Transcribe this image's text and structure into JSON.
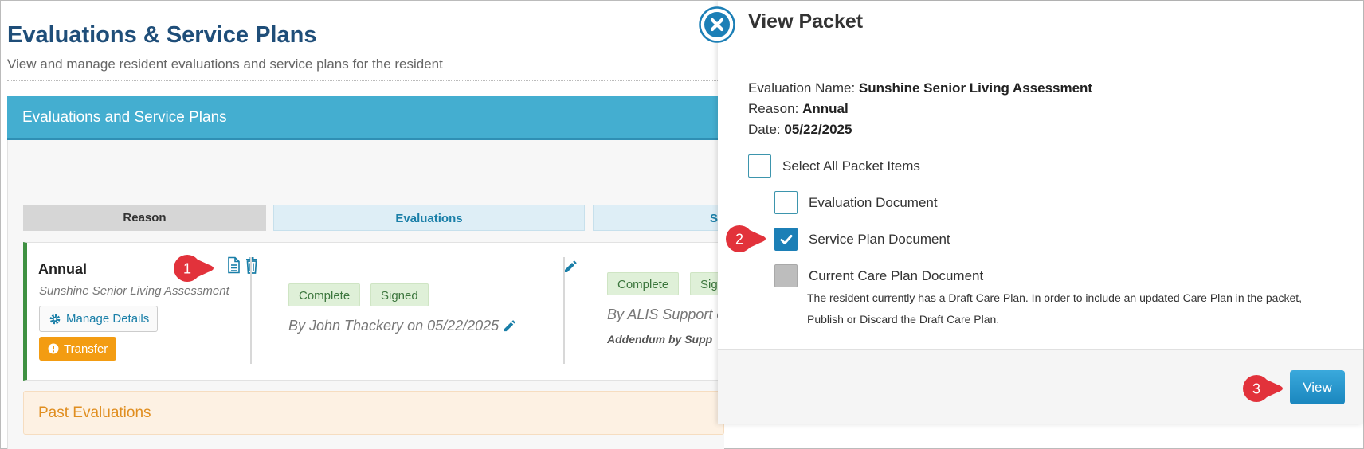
{
  "page": {
    "title": "Evaluations & Service Plans",
    "subtitle": "View and manage resident evaluations and service plans for the resident"
  },
  "panel": {
    "header": "Evaluations and Service Plans",
    "columns": {
      "reason": "Reason",
      "evaluations": "Evaluations",
      "service_plans": "S"
    }
  },
  "row": {
    "name": "Annual",
    "evaluation_name": "Sunshine Senior Living Assessment",
    "manage_label": "Manage Details",
    "transfer_label": "Transfer",
    "evaluation_badges": [
      "Complete",
      "Signed"
    ],
    "evaluation_byline": "By John Thackery on 05/22/2025",
    "plan_badges": [
      "Complete",
      "Signed"
    ],
    "plan_byline": "By ALIS Support o",
    "plan_addendum": "Addendum by Supp"
  },
  "past_evaluations": "Past Evaluations",
  "modal": {
    "title": "View Packet",
    "evaluation_name_label": "Evaluation Name:",
    "evaluation_name": "Sunshine Senior Living Assessment",
    "reason_label": "Reason:",
    "reason": "Annual",
    "date_label": "Date:",
    "date": "05/22/2025",
    "items": {
      "select_all": {
        "label": "Select All Packet Items",
        "checked": false
      },
      "evaluation_document": {
        "label": "Evaluation Document",
        "checked": false
      },
      "service_plan_document": {
        "label": "Service Plan Document",
        "checked": true
      },
      "current_care_plan_document": {
        "label": "Current Care Plan Document",
        "checked": false,
        "disabled": true
      }
    },
    "care_plan_note": "The resident currently has a Draft Care Plan. In order to include an updated Care Plan in the packet, Publish or Discard the Draft Care Plan.",
    "view_button": "View"
  },
  "callouts": [
    "1",
    "2",
    "3"
  ],
  "colors": {
    "title": "#1f4e79",
    "panel_header": "#44aed0",
    "accent_blue": "#1c7fb6",
    "success_bar": "#3f9142",
    "transfer_orange": "#f39c12",
    "callout_red": "#e2323b"
  }
}
